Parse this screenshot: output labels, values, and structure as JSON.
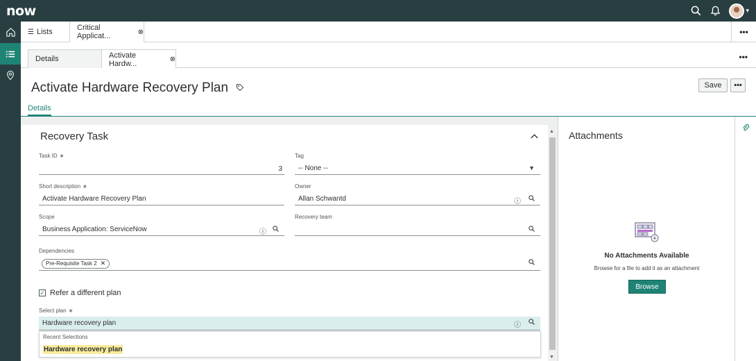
{
  "app": {
    "logo": "now"
  },
  "topbar": {
    "icons": [
      "search-icon",
      "bell-icon",
      "user-avatar"
    ]
  },
  "rail": {
    "items": [
      "home-icon",
      "list-icon",
      "map-pin-icon"
    ],
    "active": "list-icon"
  },
  "tabs": {
    "lists_label": "Lists",
    "critical_label": "Critical Applicat...",
    "more": "•••"
  },
  "inner_tabs": {
    "details_label": "Details",
    "activate_label": "Activate Hardw...",
    "more": "•••"
  },
  "record": {
    "title": "Activate Hardware Recovery Plan",
    "save_label": "Save",
    "more": "•••",
    "tab_details": "Details"
  },
  "form": {
    "section_title": "Recovery Task",
    "task_id_label": "Task ID",
    "task_id_value": "3",
    "tag_label": "Tag",
    "tag_value": "-- None --",
    "short_desc_label": "Short description",
    "short_desc_value": "Activate Hardware Recovery Plan",
    "owner_label": "Owner",
    "owner_value": "Allan Schwantd",
    "scope_label": "Scope",
    "scope_value": "Business Application: ServiceNow",
    "recovery_team_label": "Recovery team",
    "recovery_team_value": "",
    "dependencies_label": "Dependencies",
    "dependency_chip": "Pre-Requisite Task 2",
    "refer_plan_label": "Refer a different plan",
    "refer_plan_checked": true,
    "select_plan_label": "Select plan",
    "select_plan_value": "Hardware recovery plan",
    "dropdown_header": "Recent Selections",
    "dropdown_item": "Hardware recovery plan"
  },
  "attachments": {
    "title": "Attachments",
    "none": "No Attachments Available",
    "hint": "Browse for a file to add it as an attachment",
    "browse_label": "Browse"
  },
  "colors": {
    "brand_dark": "#293e40",
    "accent": "#1f8476",
    "highlight": "#f7ec9d"
  }
}
